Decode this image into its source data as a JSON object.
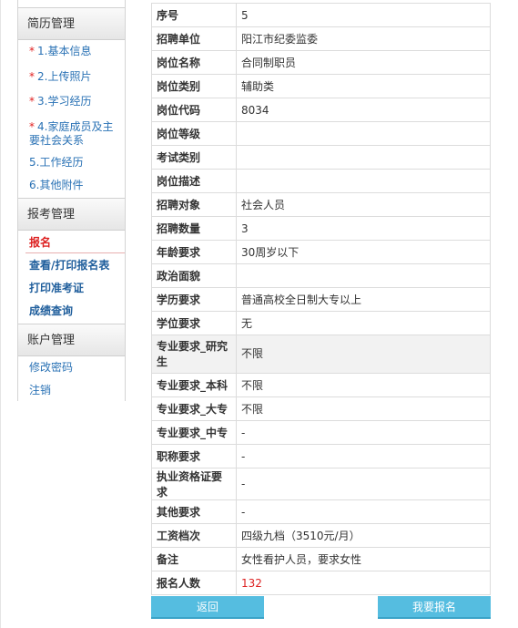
{
  "sidebar": {
    "resume_header": "简历管理",
    "resume_items": [
      {
        "star": "*",
        "label": "1.基本信息"
      },
      {
        "star": "*",
        "label": "2.上传照片"
      },
      {
        "star": "*",
        "label": "3.学习经历"
      },
      {
        "star": "*",
        "label": "4.家庭成员及主要社会关系"
      },
      {
        "star": "",
        "label": "5.工作经历"
      },
      {
        "star": "",
        "label": "6.其他附件"
      }
    ],
    "exam_header": "报考管理",
    "exam_items": [
      "报名",
      "查看/打印报名表",
      "打印准考证",
      "成绩查询"
    ],
    "account_header": "账户管理",
    "account_items": [
      "修改密码",
      "注销"
    ]
  },
  "details": [
    {
      "key": "序号",
      "value": "5"
    },
    {
      "key": "招聘单位",
      "value": "阳江市纪委监委"
    },
    {
      "key": "岗位名称",
      "value": "合同制职员"
    },
    {
      "key": "岗位类别",
      "value": "辅助类"
    },
    {
      "key": "岗位代码",
      "value": "8034"
    },
    {
      "key": "岗位等级",
      "value": ""
    },
    {
      "key": "考试类别",
      "value": ""
    },
    {
      "key": "岗位描述",
      "value": ""
    },
    {
      "key": "招聘对象",
      "value": "社会人员"
    },
    {
      "key": "招聘数量",
      "value": "3"
    },
    {
      "key": "年龄要求",
      "value": "30周岁以下"
    },
    {
      "key": "政治面貌",
      "value": ""
    },
    {
      "key": "学历要求",
      "value": "普通高校全日制大专以上"
    },
    {
      "key": "学位要求",
      "value": "无"
    },
    {
      "key": "专业要求_研究生",
      "value": "不限"
    },
    {
      "key": "专业要求_本科",
      "value": "不限"
    },
    {
      "key": "专业要求_大专",
      "value": "不限"
    },
    {
      "key": "专业要求_中专",
      "value": " -"
    },
    {
      "key": "职称要求",
      "value": " -"
    },
    {
      "key": "执业资格证要求",
      "value": " -"
    },
    {
      "key": "其他要求",
      "value": " -"
    },
    {
      "key": "工资档次",
      "value": "四级九档（3510元/月）"
    },
    {
      "key": "备注",
      "value": "女性看护人员，要求女性"
    },
    {
      "key": "报名人数",
      "value": "132"
    }
  ],
  "buttons": {
    "back": "返回",
    "apply": "我要报名"
  },
  "colors": {
    "accent": "#55bde0",
    "link": "#2a72b5",
    "red": "#d22222"
  }
}
